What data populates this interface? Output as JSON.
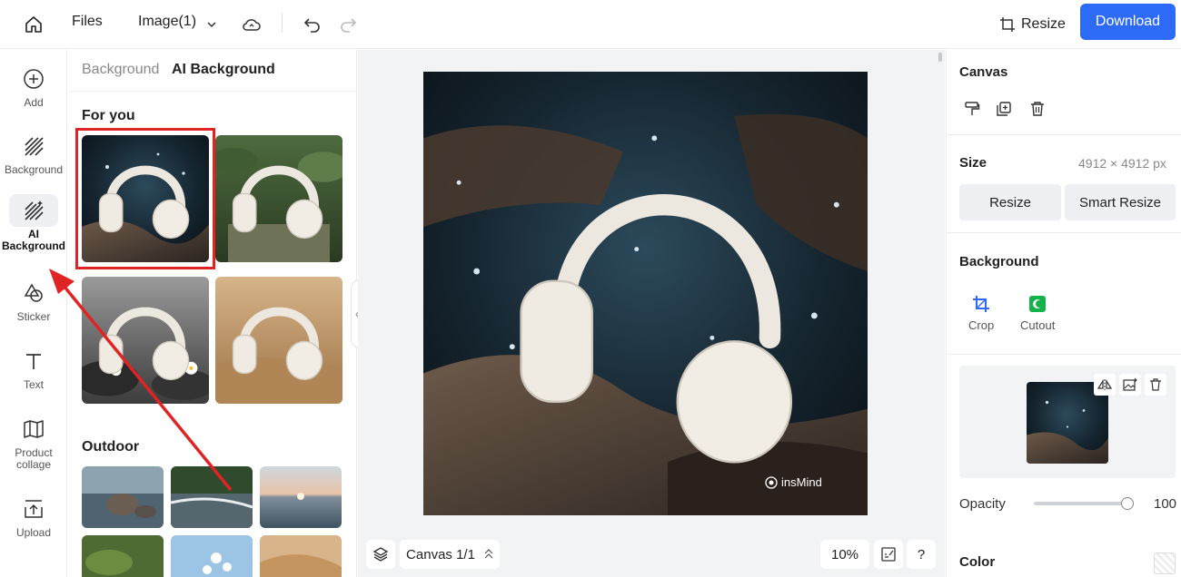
{
  "topbar": {
    "files": "Files",
    "file_name": "Image(1)",
    "resize": "Resize",
    "download": "Download"
  },
  "rail": [
    {
      "label": "Add",
      "icon": "plus-circle-icon"
    },
    {
      "label": "Background",
      "icon": "hatch-icon"
    },
    {
      "label": "AI Background",
      "icon": "ai-hatch-icon"
    },
    {
      "label": "Sticker",
      "icon": "shapes-icon"
    },
    {
      "label": "Text",
      "icon": "text-icon"
    },
    {
      "label": "Product collage",
      "icon": "collage-icon"
    },
    {
      "label": "Upload",
      "icon": "upload-icon"
    }
  ],
  "panel": {
    "tabs": [
      "Background",
      "AI Background"
    ],
    "active_tab": "AI Background",
    "sections": [
      "For you",
      "Outdoor"
    ]
  },
  "canvas": {
    "watermark": "insMind",
    "layer_label": "Canvas 1/1",
    "zoom": "10%",
    "help": "?"
  },
  "right": {
    "canvas_title": "Canvas",
    "size_title": "Size",
    "size_value": "4912 × 4912 px",
    "resize_btn": "Resize",
    "smart_resize_btn": "Smart Resize",
    "background_title": "Background",
    "crop": "Crop",
    "cutout": "Cutout",
    "opacity_label": "Opacity",
    "opacity_value": "100",
    "opacity_fraction": 1.0,
    "color_title": "Color"
  },
  "colors": {
    "accent": "#2d6af6",
    "highlight": "#e02424",
    "cutout_green": "#14b24a",
    "crop_blue": "#2d6af6"
  }
}
